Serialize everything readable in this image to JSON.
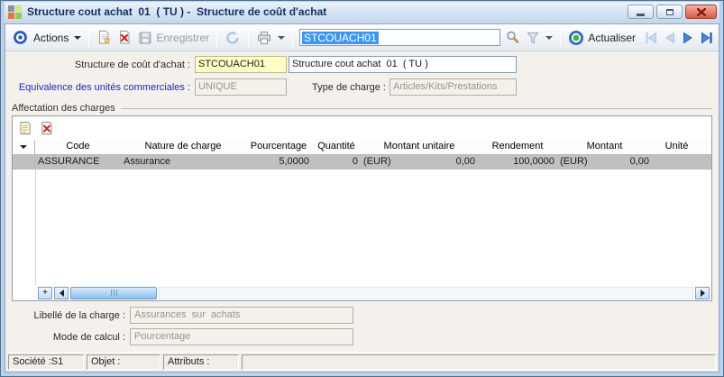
{
  "window": {
    "title": "Structure cout achat  01  ( TU ) -  Structure de coût d'achat"
  },
  "toolbar": {
    "actions_label": "Actions",
    "save_label": "Enregistrer",
    "search_value": "STCOUACH01",
    "refresh_label": "Actualiser"
  },
  "form": {
    "code_label": "Structure de coût d'achat :",
    "code_value": "STCOUACH01",
    "name_value": "Structure cout achat  01  ( TU )",
    "equivalence_label": "Equivalence des unités commerciales :",
    "equivalence_value": "UNIQUE",
    "type_charge_label": "Type de charge :",
    "type_charge_value": "Articles/Kits/Prestations"
  },
  "charges": {
    "group_title": "Affectation des charges",
    "table": {
      "columns": [
        "Code",
        "Nature de charge",
        "Pourcentage",
        "Quantité",
        "Montant unitaire",
        "Rendement",
        "Montant",
        "Unité"
      ],
      "rows": [
        {
          "code": "ASSURANCE",
          "nature": "Assurance",
          "pourcentage": "5,0000",
          "quantite": "0",
          "montant_unitaire_devise": "(EUR)",
          "montant_unitaire": "0,00",
          "rendement": "100,0000",
          "montant_devise": "(EUR)",
          "montant": "0,00",
          "unite": ""
        }
      ]
    }
  },
  "details": {
    "libelle_label": "Libellé de la charge :",
    "libelle_value": "Assurances  sur  achats",
    "mode_label": "Mode de calcul :",
    "mode_value": "Pourcentage"
  },
  "statusbar": {
    "societe": "Société :S1",
    "objet": "Objet :",
    "attributs": "Attributs :"
  },
  "colors": {
    "selection": "#3d97f2",
    "mandatory_field_bg": "#ffffc6",
    "selected_row_bg": "#c0c0c0",
    "accent_blue": "#2d5cb8"
  }
}
